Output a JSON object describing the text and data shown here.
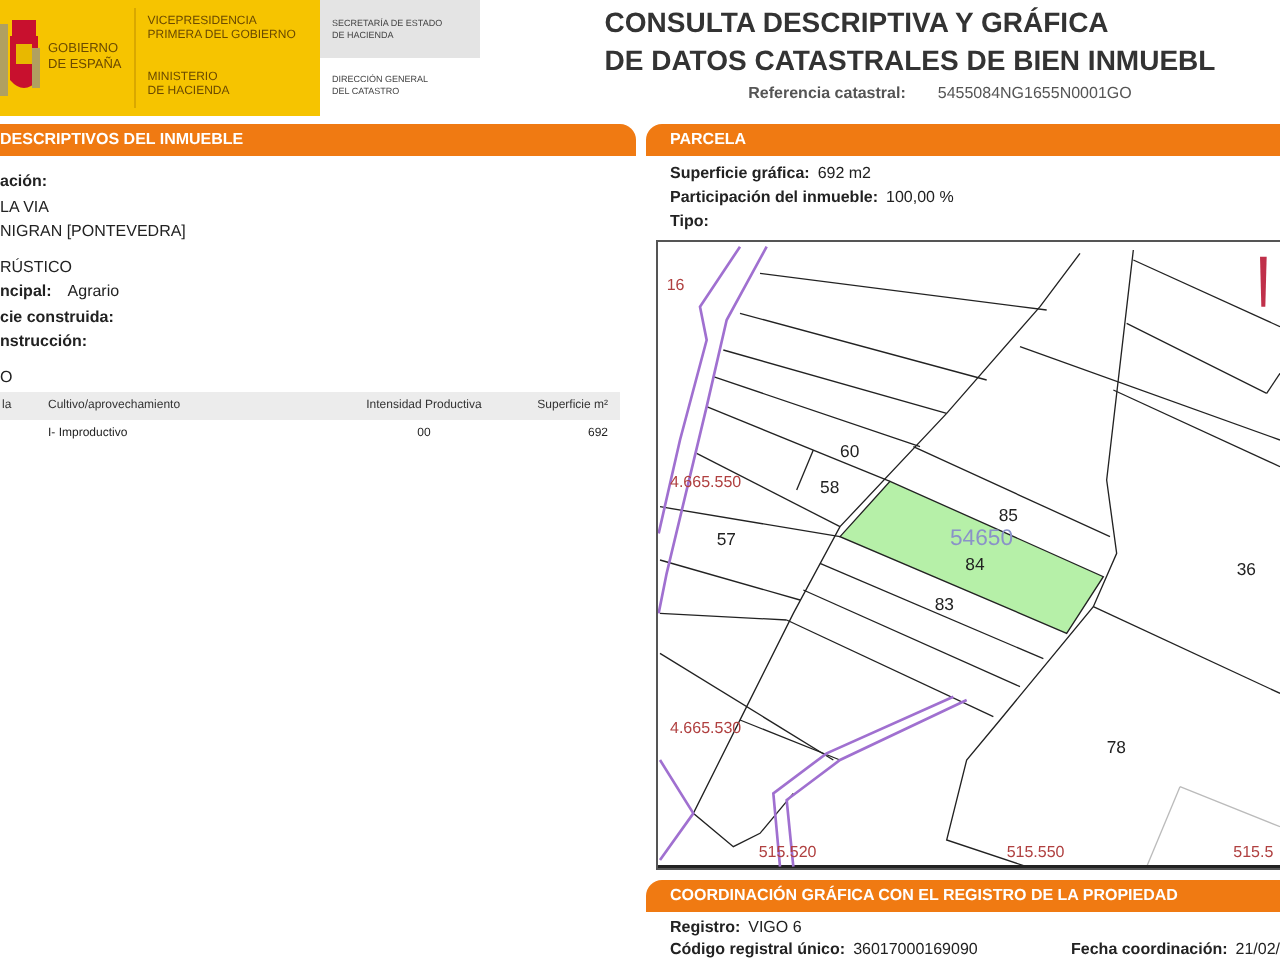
{
  "header": {
    "government": [
      "GOBIERNO",
      "DE ESPAÑA"
    ],
    "vicepresidency": [
      "VICEPRESIDENCIA",
      "PRIMERA DEL GOBIERNO"
    ],
    "ministry": [
      "MINISTERIO",
      "DE HACIENDA"
    ],
    "secretariat": [
      "SECRETARÍA DE ESTADO",
      "DE HACIENDA"
    ],
    "directorate": [
      "DIRECCIÓN GENERAL",
      "DEL CATASTRO"
    ],
    "title": [
      "CONSULTA DESCRIPTIVA Y GRÁFICA",
      "DE DATOS CATASTRALES DE BIEN INMUEBL"
    ],
    "reference_label": "Referencia catastral:",
    "reference_value": "5455084NG1655N0001GO"
  },
  "property_panel": {
    "title": "DESCRIPTIVOS DEL INMUEBLE",
    "items": [
      {
        "kind": "label",
        "text": "ación:"
      },
      {
        "kind": "value",
        "text": "LA VIA"
      },
      {
        "kind": "value",
        "text": "NIGRAN [PONTEVEDRA]"
      },
      {
        "kind": "value",
        "text": "RÚSTICO"
      },
      {
        "kind": "pair",
        "label": "ncipal:",
        "value": "Agrario"
      },
      {
        "kind": "label",
        "text": "cie construida:"
      },
      {
        "kind": "label",
        "text": "nstrucción:"
      },
      {
        "kind": "value",
        "text": "O"
      }
    ],
    "table": {
      "columns": [
        "la",
        "Cultivo/aprovechamiento",
        "Intensidad Productiva",
        "Superficie m²"
      ],
      "rows": [
        {
          "cultivo": "I- Improductivo",
          "intensity": "00",
          "surface": "692"
        }
      ]
    }
  },
  "parcel_panel": {
    "title": "PARCELA",
    "fields": [
      {
        "label": "Superficie gráfica:",
        "value": "692 m2"
      },
      {
        "label": "Participación del inmueble:",
        "value": "100,00 %"
      },
      {
        "label": "Tipo:"
      }
    ],
    "map_labels": [
      {
        "kind": "coordinate",
        "text": "16"
      },
      {
        "kind": "parcel",
        "text": "60"
      },
      {
        "kind": "parcel",
        "text": "58"
      },
      {
        "kind": "parcel",
        "text": "57"
      },
      {
        "kind": "parcel",
        "text": "85"
      },
      {
        "kind": "cadastral",
        "text": "54650"
      },
      {
        "kind": "parcel",
        "text": "84"
      },
      {
        "kind": "parcel",
        "text": "83"
      },
      {
        "kind": "parcel",
        "text": "36"
      },
      {
        "kind": "parcel",
        "text": "78"
      },
      {
        "kind": "coordinate",
        "text": "4.665.550"
      },
      {
        "kind": "coordinate",
        "text": "4.665.530"
      },
      {
        "kind": "coordinate",
        "text": "515.520"
      },
      {
        "kind": "coordinate",
        "text": "515.550"
      },
      {
        "kind": "coordinate",
        "text": "515.5"
      }
    ]
  },
  "coordination_panel": {
    "title": "COORDINACIÓN GRÁFICA CON EL REGISTRO DE LA PROPIEDAD",
    "fields": [
      {
        "label": "Registro:",
        "value": "VIGO 6"
      },
      {
        "label": "Código registral único:",
        "value": "36017000169090"
      },
      {
        "label": "Fecha coordinación:",
        "value": "21/02/"
      }
    ]
  }
}
